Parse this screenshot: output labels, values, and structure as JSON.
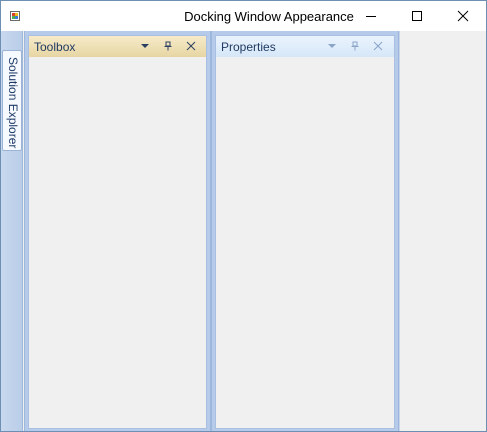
{
  "window": {
    "title": "Docking Window Appearance"
  },
  "autohide": {
    "tab_label": "Solution Explorer"
  },
  "panes": {
    "toolbox": {
      "title": "Toolbox"
    },
    "properties": {
      "title": "Properties"
    }
  },
  "icons": {
    "app": "app-icon",
    "minimize": "minimize-icon",
    "maximize": "maximize-icon",
    "close": "close-icon",
    "dropdown": "chevron-down-icon",
    "pin": "pin-icon",
    "pane_close": "close-icon"
  },
  "colors": {
    "toolbox_header": "#e7d6a3",
    "properties_header": "#d6e7f8",
    "dock_frame": "#b6cbea",
    "pane_title_text": "#1f3a63"
  }
}
